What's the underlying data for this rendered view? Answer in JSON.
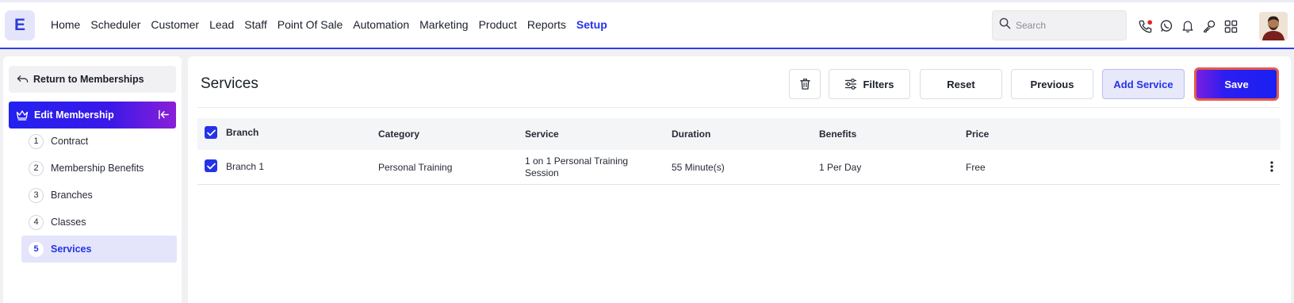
{
  "app": {
    "logo_letter": "E",
    "accent_color": "#2433e8"
  },
  "nav": {
    "items": [
      "Home",
      "Scheduler",
      "Customer",
      "Lead",
      "Staff",
      "Point Of Sale",
      "Automation",
      "Marketing",
      "Product",
      "Reports",
      "Setup"
    ],
    "active": "Setup"
  },
  "search": {
    "placeholder": "Search"
  },
  "toolbar_icons": [
    "phone-icon",
    "whatsapp-icon",
    "bell-icon",
    "key-icon",
    "apps-grid-icon"
  ],
  "sidebar": {
    "return_label": "Return to Memberships",
    "edit_label": "Edit Membership",
    "steps": [
      {
        "num": "1",
        "label": "Contract"
      },
      {
        "num": "2",
        "label": "Membership Benefits"
      },
      {
        "num": "3",
        "label": "Branches"
      },
      {
        "num": "4",
        "label": "Classes"
      },
      {
        "num": "5",
        "label": "Services"
      }
    ],
    "active_step": 5
  },
  "main": {
    "title": "Services",
    "buttons": {
      "filters": "Filters",
      "reset": "Reset",
      "previous": "Previous",
      "add_service": "Add Service",
      "save": "Save"
    },
    "table": {
      "headers": [
        "Branch",
        "Category",
        "Service",
        "Duration",
        "Benefits",
        "Price"
      ],
      "header_checked": true,
      "rows": [
        {
          "checked": true,
          "branch": "Branch 1",
          "category": "Personal Training",
          "service_line1": "1 on 1 Personal Training",
          "service_line2": "Session",
          "duration": "55 Minute(s)",
          "benefits": "1 Per Day",
          "price": "Free"
        }
      ]
    }
  }
}
